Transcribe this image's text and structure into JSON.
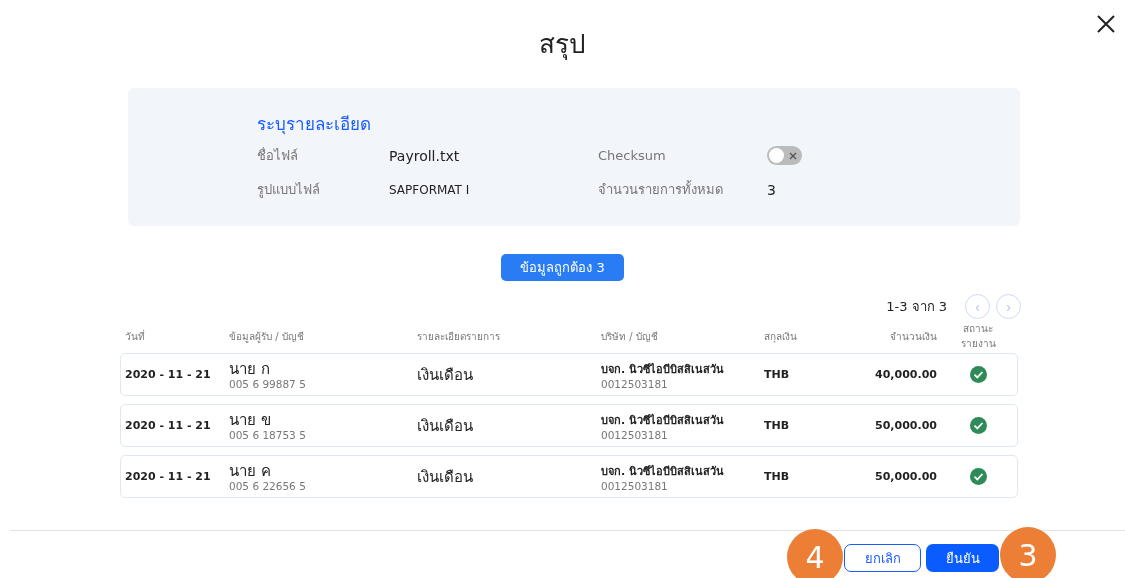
{
  "title": "สรุป",
  "details": {
    "heading": "ระบุรายละเอียด",
    "fields": [
      {
        "label": "ชื่อไฟล์",
        "value": "Payroll.txt"
      },
      {
        "label": "รูปแบบไฟล์",
        "value": "SAPFORMAT I"
      }
    ],
    "checksum": {
      "label": "Checksum",
      "on": false
    },
    "total": {
      "label": "จำนวนรายการทั้งหมด",
      "value": "3"
    }
  },
  "valid_button": "ข้อมูลถูกต้อง 3",
  "pagination": {
    "range": "1-3 จาก 3",
    "prev": "‹",
    "next": "›"
  },
  "table": {
    "columns": [
      "วันที่",
      "ข้อมูลผู้รับ / บัญชี",
      "รายละเอียดรายการ",
      "บริษัท / บัญชี",
      "สกุลเงิน",
      "จำนวนเงิน",
      "สถานะ รายงาน"
    ],
    "rows": [
      {
        "date": "2020 - 11 - 21",
        "name": "นาย ก",
        "account": "005 6 99887 5",
        "detail": "เงินเดือน",
        "company": "บจก. นิวซีไอบีบิสสิเนสวัน",
        "company_account": "0012503181",
        "currency": "THB",
        "amount": "40,000.00",
        "valid": true
      },
      {
        "date": "2020 - 11 - 21",
        "name": "นาย ข",
        "account": "005 6 18753 5",
        "detail": "เงินเดือน",
        "company": "บจก. นิวซีไอบีบิสสิเนสวัน",
        "company_account": "0012503181",
        "currency": "THB",
        "amount": "50,000.00",
        "valid": true
      },
      {
        "date": "2020 - 11 - 21",
        "name": "นาย ค",
        "account": "005 6 22656 5",
        "detail": "เงินเดือน",
        "company": "บจก. นิวซีไอบีบิสสิเนสวัน",
        "company_account": "0012503181",
        "currency": "THB",
        "amount": "50,000.00",
        "valid": true
      }
    ]
  },
  "footer": {
    "cancel": "ยกเลิก",
    "confirm": "ยืนยัน",
    "markers": [
      "4",
      "3"
    ]
  }
}
